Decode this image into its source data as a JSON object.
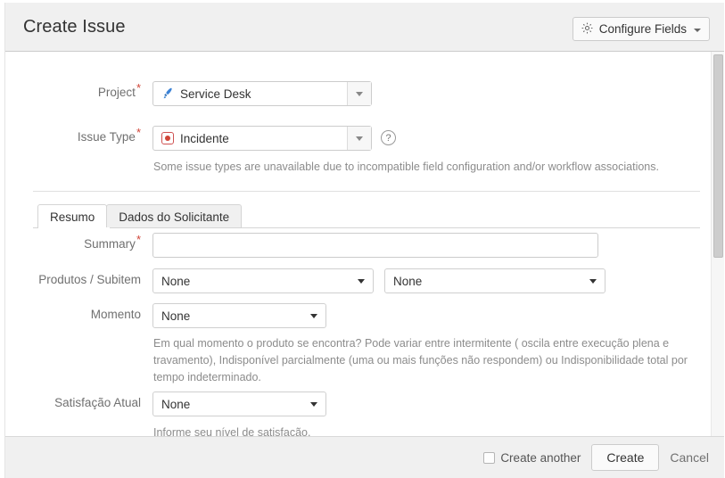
{
  "header": {
    "title": "Create Issue",
    "configure_fields_label": "Configure Fields",
    "gear_icon": "gear-icon",
    "caret_icon": "chevron-down-icon"
  },
  "form": {
    "project": {
      "label": "Project",
      "required": true,
      "value": "Service Desk",
      "icon": "rocket-icon"
    },
    "issue_type": {
      "label": "Issue Type",
      "required": true,
      "value": "Incidente",
      "icon": "issue-type-incident-icon",
      "help_icon": "question-circle-icon",
      "description": "Some issue types are unavailable due to incompatible field configuration and/or workflow associations."
    },
    "tabs": [
      {
        "label": "Resumo",
        "active": true
      },
      {
        "label": "Dados do Solicitante",
        "active": false
      }
    ],
    "summary": {
      "label": "Summary",
      "required": true,
      "value": "",
      "placeholder": ""
    },
    "produtos_subitem": {
      "label": "Produtos / Subitem",
      "required": false,
      "value_produto": "None",
      "value_subitem": "None"
    },
    "momento": {
      "label": "Momento",
      "required": false,
      "value": "None",
      "description": "Em qual momento o produto se encontra? Pode variar entre intermitente ( oscila entre execução plena e travamento), Indisponível parcialmente (uma ou mais funções não respondem) ou Indisponibilidade total por tempo indeterminado."
    },
    "satisfacao_atual": {
      "label": "Satisfação Atual",
      "required": false,
      "value": "None",
      "description": "Informe seu nível de satisfação."
    }
  },
  "footer": {
    "create_another_label": "Create another",
    "create_another_checked": false,
    "create_label": "Create",
    "cancel_label": "Cancel"
  },
  "colors": {
    "required_marker": "#d04437",
    "header_bg": "#f0f0f0",
    "issue_type_icon": "#d04437",
    "project_icon": "#2f7cc4",
    "label_text": "#707070",
    "help_text": "#8c8c8c"
  }
}
